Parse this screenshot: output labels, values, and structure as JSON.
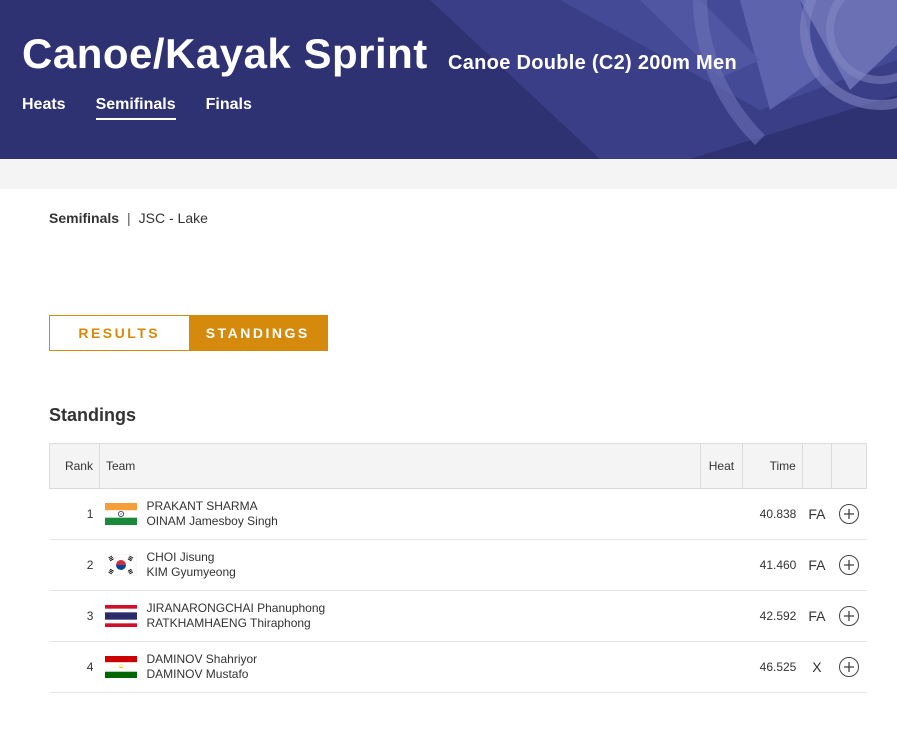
{
  "header": {
    "sport_title": "Canoe/Kayak Sprint",
    "event_title": "Canoe Double (C2) 200m Men",
    "phase_tabs": [
      {
        "label": "Heats"
      },
      {
        "label": "Semifinals"
      },
      {
        "label": "Finals"
      }
    ],
    "active_tab": "Semifinals",
    "brand_color": "#2e3172"
  },
  "breadcrumb": {
    "phase": "Semifinals",
    "separator": "|",
    "venue": "JSC - Lake"
  },
  "view_toggle": {
    "results_label": "RESULTS",
    "standings_label": "STANDINGS",
    "active": "STANDINGS",
    "accent_color": "#d68a0b"
  },
  "standings": {
    "title": "Standings",
    "columns": {
      "rank": "Rank",
      "team": "Team",
      "heat": "Heat",
      "time": "Time"
    },
    "rows": [
      {
        "rank": "1",
        "flag": "india-flag",
        "athlete1": "PRAKANT SHARMA",
        "athlete2": "OINAM Jamesboy Singh",
        "heat": "",
        "time": "40.838",
        "qual": "FA"
      },
      {
        "rank": "2",
        "flag": "korea-flag",
        "athlete1": "CHOI Jisung",
        "athlete2": "KIM Gyumyeong",
        "heat": "",
        "time": "41.460",
        "qual": "FA"
      },
      {
        "rank": "3",
        "flag": "thailand-flag",
        "athlete1": "JIRANARONGCHAI Phanuphong",
        "athlete2": "RATKHAMHAENG Thiraphong",
        "heat": "",
        "time": "42.592",
        "qual": "FA"
      },
      {
        "rank": "4",
        "flag": "tajikistan-flag",
        "athlete1": "DAMINOV Shahriyor",
        "athlete2": "DAMINOV Mustafo",
        "heat": "",
        "time": "46.525",
        "qual": "X"
      }
    ]
  }
}
